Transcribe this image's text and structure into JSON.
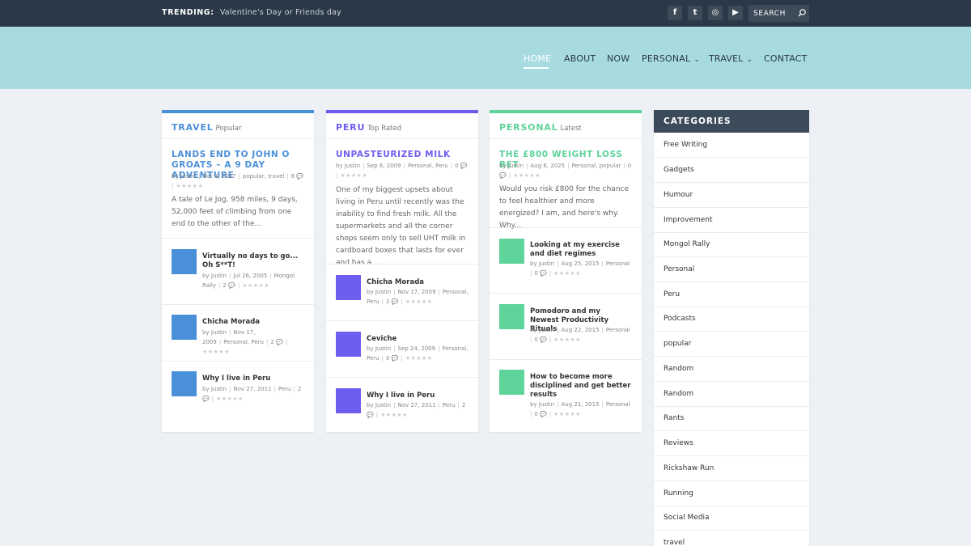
{
  "topbar": {
    "trending_label": "TRENDING:",
    "trending_text": "Valentine's Day or Friends day",
    "social": [
      {
        "icon": "facebook-icon",
        "glyph": "f"
      },
      {
        "icon": "twitter-icon",
        "glyph": "t"
      },
      {
        "icon": "instagram-icon",
        "glyph": "◎"
      },
      {
        "icon": "youtube-icon",
        "glyph": "▶"
      }
    ],
    "search_placeholder": "SEARCH"
  },
  "nav": {
    "home": "HOME",
    "about": "ABOUT",
    "now": "NOW",
    "personal": "PERSONAL",
    "travel": "TRAVEL",
    "contact": "CONTACT"
  },
  "colors": {
    "travel": "#4a90d9",
    "peru": "#6d5ef0",
    "personal": "#5ed39a",
    "header_bg": "#a7dbe0",
    "topbar_bg": "#2a3847"
  },
  "cards": {
    "travel": {
      "category": "TRAVEL",
      "subtitle": "Popular",
      "featured": {
        "title": "LANDS END TO JOHN O GROATS – A 9 DAY ADVENTURE",
        "author": "Justin",
        "date": "Oct 4, 2017",
        "tags": "popular, travel",
        "comments": "6",
        "excerpt": "A tale of Le Jog, 958 miles, 9 days, 52,000 feet of climbing from one end to the other of the..."
      },
      "posts": [
        {
          "title": "Virtually no days to go... Oh S**T!",
          "author": "Justin",
          "date": "Jul 26, 2005",
          "tags": "Mongol Rally",
          "comments": "2"
        },
        {
          "title": "Chicha Morada",
          "author": "Justin",
          "date": "Nov 17, 2009",
          "tags": "Personal, Peru",
          "comments": "2"
        },
        {
          "title": "Why I live in Peru",
          "author": "Justin",
          "date": "Nov 27, 2011",
          "tags": "Peru",
          "comments": "2"
        }
      ]
    },
    "peru": {
      "category": "PERU",
      "subtitle": "Top Rated",
      "featured": {
        "title": "UNPASTEURIZED MILK",
        "author": "Justin",
        "date": "Sep 6, 2009",
        "tags": "Personal, Peru",
        "comments": "0",
        "excerpt": "One of my biggest upsets about living in Peru until recently was the inability to find fresh milk. All the supermarkets and all the corner shops seem only to sell UHT milk in cardboard boxes that lasts for ever and has a..."
      },
      "posts": [
        {
          "title": "Chicha Morada",
          "author": "Justin",
          "date": "Nov 17, 2009",
          "tags": "Personal, Peru",
          "comments": "2"
        },
        {
          "title": "Ceviche",
          "author": "Justin",
          "date": "Sep 24, 2009",
          "tags": "Personal, Peru",
          "comments": "0"
        },
        {
          "title": "Why I live in Peru",
          "author": "Justin",
          "date": "Nov 27, 2011",
          "tags": "Peru",
          "comments": "2"
        }
      ]
    },
    "personal": {
      "category": "PERSONAL",
      "subtitle": "Latest",
      "featured": {
        "title": "THE £800 WEIGHT LOSS BET",
        "author": "Justin",
        "date": "Aug 6, 2025",
        "tags": "Personal, popular",
        "comments": "0",
        "excerpt": "Would you risk £800 for the chance to feel healthier and more energized? I am, and here's why. Why..."
      },
      "posts": [
        {
          "title": "Looking at my exercise and diet regimes",
          "author": "Justin",
          "date": "Aug 25, 2015",
          "tags": "Personal",
          "comments": "0"
        },
        {
          "title": "Pomodoro and my Newest Productivity Rituals",
          "author": "Justin",
          "date": "Aug 22, 2015",
          "tags": "Personal",
          "comments": "0"
        },
        {
          "title": "How to become more disciplined and get better results",
          "author": "Justin",
          "date": "Aug 21, 2015",
          "tags": "Personal",
          "comments": "0"
        }
      ]
    }
  },
  "sidebar": {
    "title": "CATEGORIES",
    "items": [
      "Free Writing",
      "Gadgets",
      "Humour",
      "Improvement",
      "Mongol Rally",
      "Personal",
      "Peru",
      "Podcasts",
      "popular",
      "Random",
      "Random",
      "Rants",
      "Reviews",
      "Rickshaw Run",
      "Running",
      "Social Media",
      "travel"
    ]
  },
  "meta_labels": {
    "by": "by",
    "stars": "★★★★★"
  }
}
